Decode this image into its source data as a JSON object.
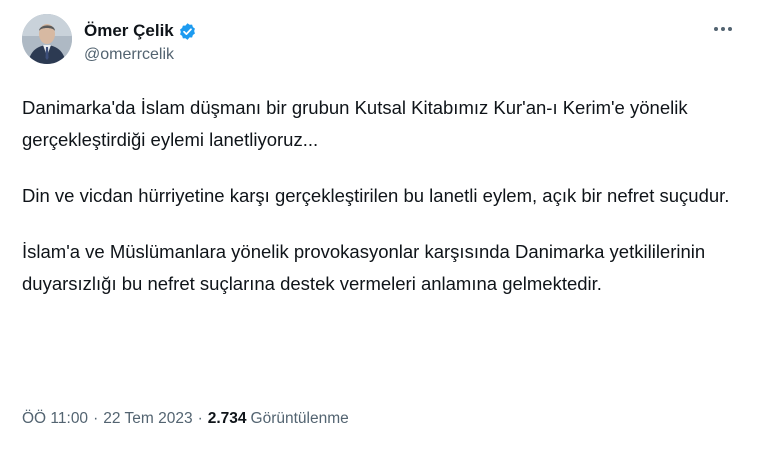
{
  "author": {
    "display_name": "Ömer Çelik",
    "handle": "@omerrcelik",
    "verified": true,
    "verified_color": "#1d9bf0"
  },
  "more_icon": "more-horizontal-icon",
  "tweet": {
    "paragraphs": [
      "Danimarka'da İslam düşmanı bir grubun Kutsal Kitabımız Kur'an-ı Kerim'e yönelik gerçekleştirdiği eylemi lanetliyoruz...",
      "Din ve vicdan hürriyetine karşı gerçekleştirilen bu lanetli eylem, açık bir nefret suçudur.",
      "İslam'a ve Müslümanlara yönelik provokasyonlar karşısında Danimarka yetkililerinin duyarsızlığı bu nefret suçlarına destek vermeleri anlamına gelmektedir."
    ]
  },
  "meta": {
    "time": "ÖÖ 11:00",
    "separator": "·",
    "date": "22 Tem 2023",
    "views_count": "2.734",
    "views_label": "Görüntülenme"
  }
}
